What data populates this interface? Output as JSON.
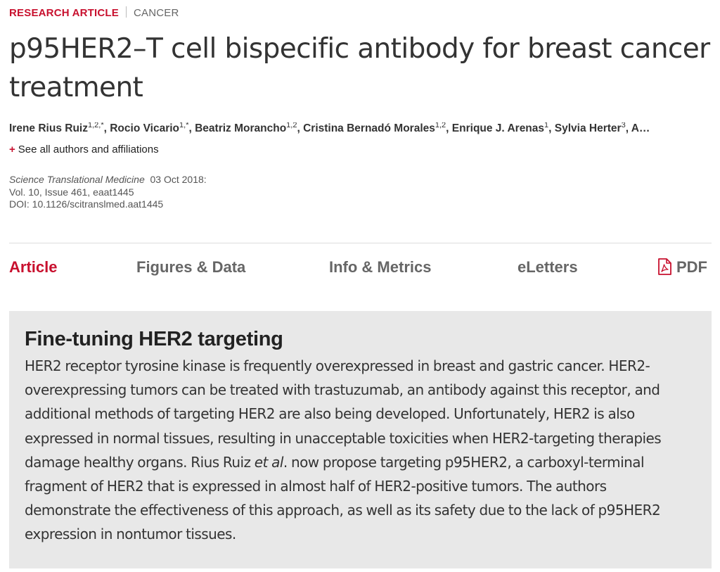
{
  "article": {
    "type": "RESEARCH ARTICLE",
    "subject": "CANCER",
    "title": "p95HER2–T cell bispecific antibody for breast cancer treatment"
  },
  "authors": [
    {
      "name": "Irene Rius Ruiz",
      "sup": "1,2,*"
    },
    {
      "name": "Rocio Vicario",
      "sup": "1,*"
    },
    {
      "name": "Beatriz Morancho",
      "sup": "1,2"
    },
    {
      "name": "Cristina Bernadó Morales",
      "sup": "1,2"
    },
    {
      "name": "Enrique J. Arenas",
      "sup": "1"
    },
    {
      "name": "Sylvia Herter",
      "sup": "3"
    },
    {
      "name": "A…",
      "sup": ""
    }
  ],
  "see_all": {
    "plus": "+",
    "label": "See all authors and affiliations"
  },
  "citation": {
    "journal": "Science Translational Medicine",
    "date": "03 Oct 2018:",
    "volume": "Vol. 10, Issue 461, eaat1445",
    "doi": "DOI: 10.1126/scitranslmed.aat1445"
  },
  "tabs": {
    "article": "Article",
    "figures": "Figures & Data",
    "info": "Info & Metrics",
    "eletters": "eLetters",
    "pdf": "PDF"
  },
  "colors": {
    "accent": "#c8102e",
    "summary_bg": "#e8e8e8"
  },
  "icons": {
    "pdf": "pdf-file-icon"
  },
  "summary": {
    "title": "Fine-tuning HER2 targeting",
    "body_before_italic": "HER2 receptor tyrosine kinase is frequently overexpressed in breast and gastric cancer. HER2-overexpressing tumors can be treated with trastuzumab, an antibody against this receptor, and additional methods of targeting HER2 are also being developed. Unfortunately, HER2 is also expressed in normal tissues, resulting in unacceptable toxicities when HER2-targeting therapies damage healthy organs. Rius Ruiz ",
    "italic": "et al",
    "body_after_italic": ". now propose targeting p95HER2, a carboxyl-terminal fragment of HER2 that is expressed in almost half of HER2-positive tumors. The authors demonstrate the effectiveness of this approach, as well as its safety due to the lack of p95HER2 expression in nontumor tissues."
  }
}
